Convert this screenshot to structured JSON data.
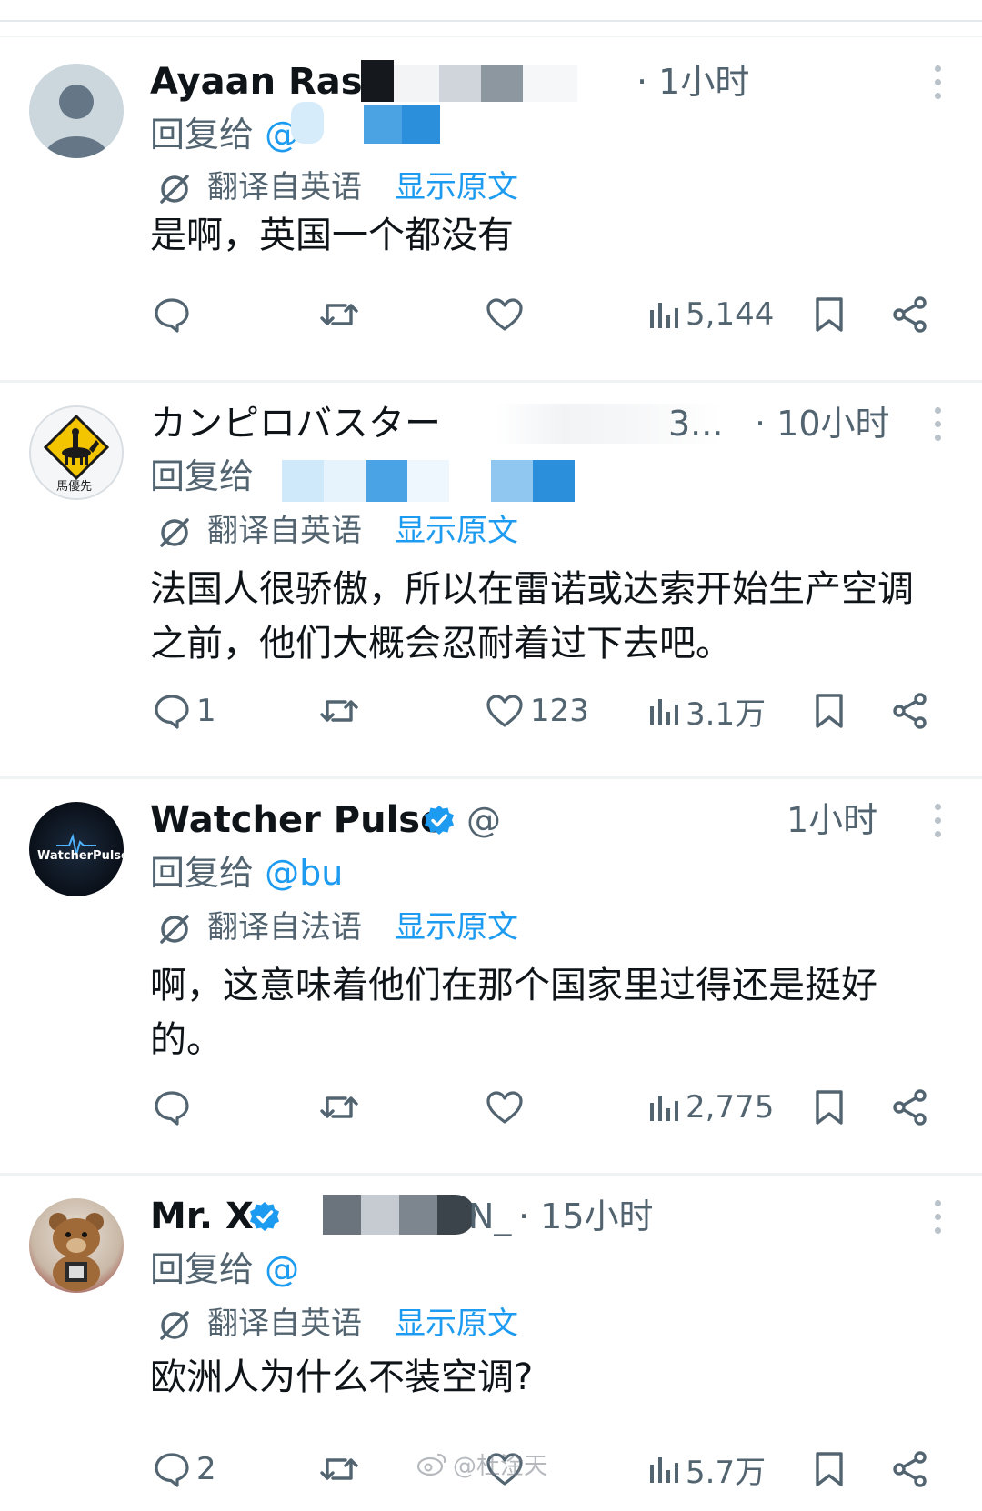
{
  "posts": [
    {
      "name": "Ayaan Rash",
      "handle": "",
      "time": "· 1小时",
      "reply_label": "回复给",
      "reply_handle": "@",
      "translated_label": "翻译自英语",
      "show_original": "显示原文",
      "text": "是啊，英国一个都没有",
      "replies": "",
      "retweets": "",
      "likes": "",
      "views": "5,144"
    },
    {
      "name": "カンピロバスター",
      "handle": "3...",
      "time": "· 10小时",
      "reply_label": "回复给",
      "reply_handle": "",
      "translated_label": "翻译自英语",
      "show_original": "显示原文",
      "text": "法国人很骄傲，所以在雷诺或达索开始生产空调之前，他们大概会忍耐着过下去吧。",
      "replies": "1",
      "retweets": "",
      "likes": "123",
      "views": "3.1万"
    },
    {
      "name": "Watcher Pulse",
      "handle": "@",
      "time": "1小时",
      "reply_label": "回复给",
      "reply_handle": "@bu",
      "translated_label": "翻译自法语",
      "show_original": "显示原文",
      "text": "啊，这意味着他们在那个国家里过得还是挺好的。",
      "replies": "",
      "retweets": "",
      "likes": "",
      "views": "2,775"
    },
    {
      "name": "Mr. X",
      "handle": "N_",
      "time": "· 15小时",
      "reply_label": "回复给",
      "reply_handle": "@",
      "translated_label": "翻译自英语",
      "show_original": "显示原文",
      "text": "欧洲人为什么不装空调?",
      "replies": "2",
      "retweets": "",
      "likes": "",
      "views": "5.7万"
    }
  ],
  "avatars": {
    "post1": "default-person-avatar",
    "post2": "horse-rider-sign-avatar",
    "post3": "watcherpulse-logo-avatar",
    "post4": "teddy-bear-avatar"
  },
  "avatar_text": {
    "post2": "馬優先",
    "post3": "WatcherPulse"
  },
  "watermark": "@杜淦天",
  "colors": {
    "accent": "#1d9bf0",
    "muted": "#536471",
    "text": "#0f1419",
    "divider": "#eff3f4"
  }
}
